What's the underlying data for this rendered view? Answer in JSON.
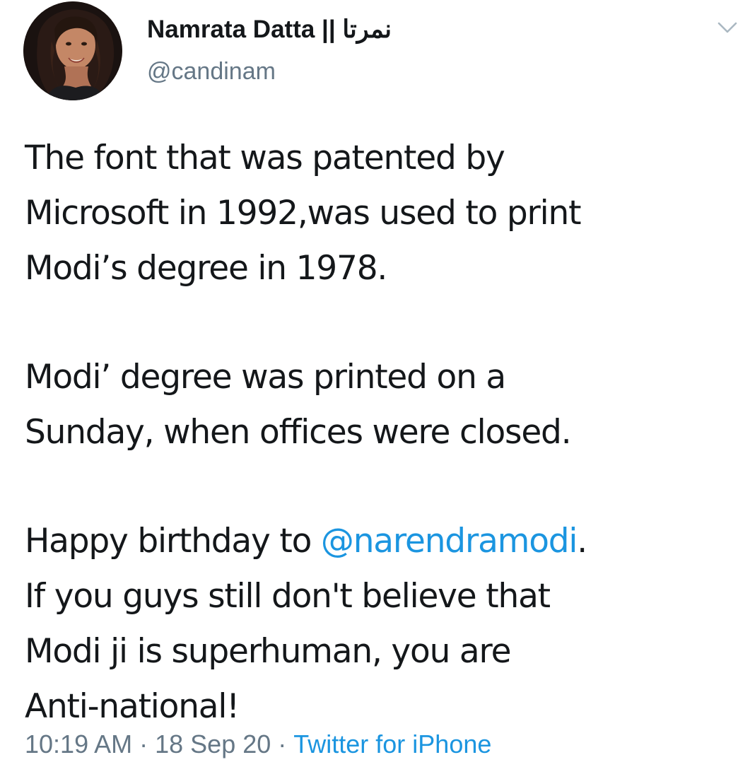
{
  "author": {
    "display_name": "Namrata Datta || نمرتا",
    "handle": "@candinam"
  },
  "tweet": {
    "para1": {
      "line1": "The font that was patented by",
      "line2": "Microsoft in 1992,was used to print",
      "line3": "Modi’s degree in 1978."
    },
    "para2": {
      "line1": "Modi’ degree was printed on a",
      "line2": "Sunday, when offices were closed."
    },
    "para3": {
      "line1_prefix": "Happy birthday to ",
      "mention": "@narendramodi",
      "line1_suffix": ".",
      "line2": "If you guys still don't believe that",
      "line3": "Modi ji is superhuman, you are",
      "line4": "Anti-national!"
    }
  },
  "meta": {
    "time": "10:19 AM",
    "separator": "·",
    "date": "18 Sep 20",
    "source": "Twitter for iPhone"
  },
  "icons": {
    "caret": "chevron-down-icon",
    "avatar": "profile-photo"
  },
  "colors": {
    "link": "#1b95e0",
    "secondary": "#657786",
    "text": "#14171a"
  }
}
